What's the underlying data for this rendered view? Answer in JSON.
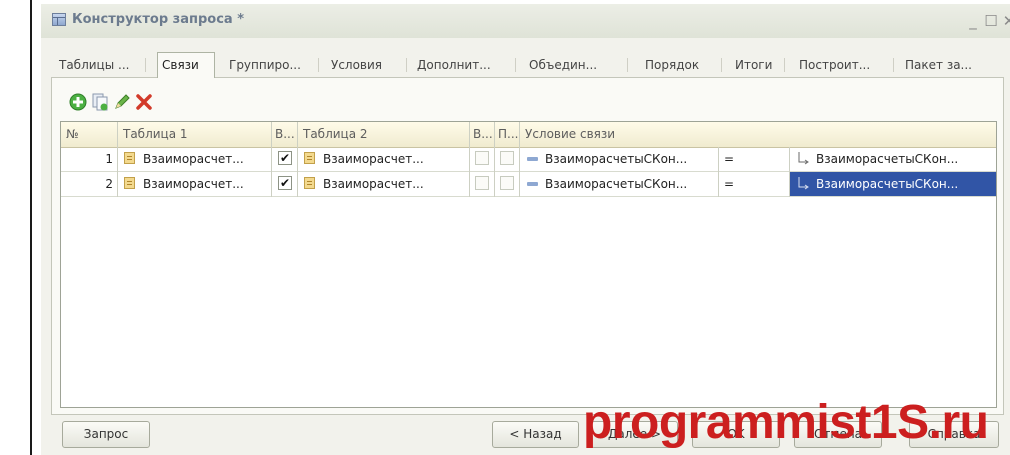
{
  "window": {
    "title": "Конструктор запроса *"
  },
  "tabs": [
    {
      "label": "Таблицы ..."
    },
    {
      "label": "Связи"
    },
    {
      "label": "Группиро..."
    },
    {
      "label": "Условия"
    },
    {
      "label": "Дополнит..."
    },
    {
      "label": "Объедин..."
    },
    {
      "label": "Порядок"
    },
    {
      "label": "Итоги"
    },
    {
      "label": "Построит..."
    },
    {
      "label": "Пакет за..."
    }
  ],
  "grid": {
    "headers": {
      "num": "№",
      "table1": "Таблица 1",
      "all1": "В...",
      "table2": "Таблица 2",
      "all2": "В...",
      "custom": "П...",
      "condition": "Условие связи"
    },
    "rows": [
      {
        "num": "1",
        "table1": "Взаиморасчет...",
        "all1_checked": true,
        "table2": "Взаиморасчет...",
        "all2_checked": false,
        "custom_checked": false,
        "cond_left": "ВзаиморасчетыСКон...",
        "cond_op": "=",
        "cond_right": "ВзаиморасчетыСКон..."
      },
      {
        "num": "2",
        "table1": "Взаиморасчет...",
        "all1_checked": true,
        "table2": "Взаиморасчет...",
        "all2_checked": false,
        "custom_checked": false,
        "cond_left": "ВзаиморасчетыСКон...",
        "cond_op": "=",
        "cond_right": "ВзаиморасчетыСКон..."
      }
    ]
  },
  "buttons": {
    "query": "Запрос",
    "back": "< Назад",
    "next": "Далее >",
    "ok": "OK",
    "cancel": "Отмена",
    "help": "Справка"
  },
  "watermark": "programmist1S.ru",
  "colors": {
    "selection": "#3155a6",
    "watermark": "#cc1f1f",
    "add": "#3fa935",
    "delete": "#d23a2a"
  }
}
